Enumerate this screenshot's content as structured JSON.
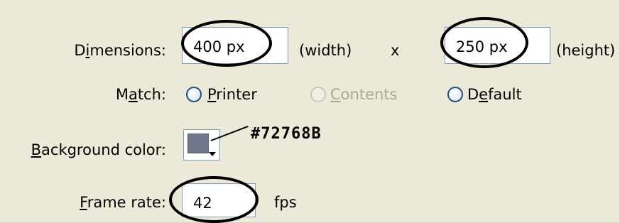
{
  "dimensions": {
    "label": "Dimensions:",
    "width_value": "400 px",
    "width_unit": "(width)",
    "separator": "x",
    "height_value": "250 px",
    "height_unit": "(height)"
  },
  "match": {
    "label": "Match:",
    "options": [
      {
        "label": "Printer",
        "enabled": true,
        "selected": false
      },
      {
        "label": "Contents",
        "enabled": false,
        "selected": false
      },
      {
        "label": "Default",
        "enabled": true,
        "selected": false
      }
    ]
  },
  "background_color": {
    "label": "Background color:",
    "swatch_color": "#72768B",
    "annotation": "#72768B"
  },
  "frame_rate": {
    "label": "Frame rate:",
    "value": "42",
    "unit": "fps"
  }
}
